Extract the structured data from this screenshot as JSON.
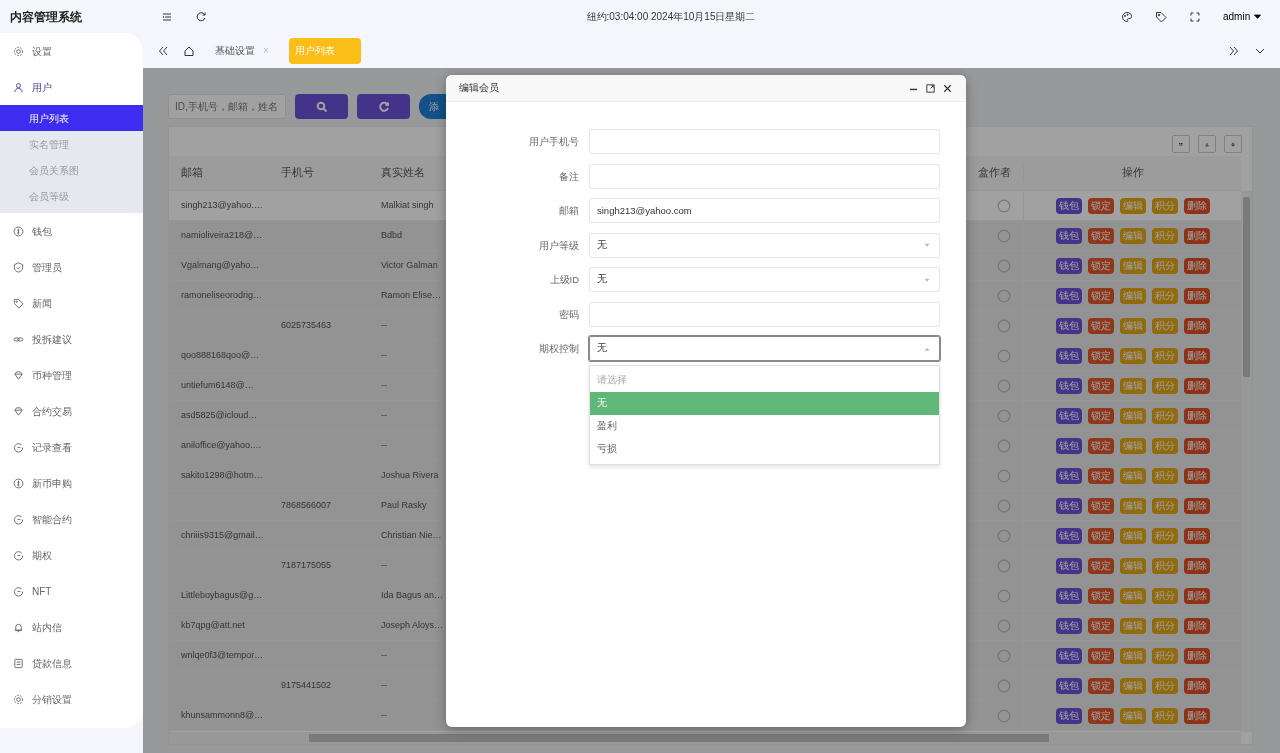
{
  "sidebar": {
    "title": "内容管理系统",
    "items": [
      {
        "label": "设置",
        "expanded": false
      },
      {
        "label": "用户",
        "expanded": true,
        "children": [
          {
            "label": "用户列表",
            "selected": true
          },
          {
            "label": "实名管理",
            "selected": false
          },
          {
            "label": "会员关系图",
            "selected": false
          },
          {
            "label": "会员等级",
            "selected": false
          }
        ]
      },
      {
        "label": "钱包",
        "expanded": false
      },
      {
        "label": "管理员",
        "expanded": false
      },
      {
        "label": "新闻",
        "expanded": false
      },
      {
        "label": "投拆建议",
        "expanded": false
      },
      {
        "label": "币种管理",
        "expanded": false
      },
      {
        "label": "合约交易",
        "expanded": false
      },
      {
        "label": "记录查看",
        "expanded": false
      },
      {
        "label": "新币申购",
        "expanded": false
      },
      {
        "label": "智能合约",
        "expanded": false
      },
      {
        "label": "期权",
        "expanded": false
      },
      {
        "label": "NFT",
        "expanded": false
      },
      {
        "label": "站内信",
        "expanded": false
      },
      {
        "label": "贷款信息",
        "expanded": false
      },
      {
        "label": "分销设置",
        "expanded": false
      }
    ]
  },
  "topbar": {
    "clock": "纽约:03:04:00 2024年10月15日星期二",
    "user": "admin"
  },
  "tabs": [
    {
      "label": "基础设置",
      "selected": false,
      "close": "×"
    },
    {
      "label": "用户列表",
      "selected": true
    }
  ],
  "toolbar": {
    "search": {
      "placeholder": "ID,手机号，邮箱，姓名"
    },
    "add_button": "添"
  },
  "table": {
    "columns": [
      "邮箱",
      "手机号",
      "真实姓名",
      "盒作者",
      "操作"
    ],
    "rows": [
      {
        "email": "singh213@yahoo.…",
        "name": "Malkiat singh",
        "selected": true,
        "actions": [
          "钱包",
          "锁定",
          "编辑",
          "积分",
          "删除"
        ]
      },
      {
        "email": "namioliveira218@…",
        "name": "Bdbd",
        "selected": false,
        "actions": [
          "钱包",
          "锁定",
          "编辑",
          "积分",
          "删除"
        ]
      },
      {
        "email": "Vgalmang@yaho…",
        "name": "Victor Galman",
        "selected": false,
        "actions": [
          "钱包",
          "锁定",
          "编辑",
          "积分",
          "删除"
        ]
      },
      {
        "email": "ramoneliseorodrig…",
        "name": "Ramon Elise…",
        "selected": false,
        "actions": [
          "钱包",
          "锁定",
          "编辑",
          "积分",
          "删除"
        ]
      },
      {
        "phone": "6025735463",
        "name": "--",
        "selected": false,
        "actions": [
          "钱包",
          "锁定",
          "编辑",
          "积分",
          "删除"
        ]
      },
      {
        "email": "qoo888168qoo@…",
        "name": "--",
        "selected": false,
        "actions": [
          "钱包",
          "锁定",
          "编辑",
          "积分",
          "删除"
        ]
      },
      {
        "email": "untiefum6148@…",
        "name": "--",
        "selected": false,
        "actions": [
          "钱包",
          "锁定",
          "编辑",
          "积分",
          "删除"
        ]
      },
      {
        "email": "asd5825@icloud…",
        "name": "--",
        "selected": false,
        "actions": [
          "钱包",
          "锁定",
          "编辑",
          "积分",
          "删除"
        ]
      },
      {
        "email": "aniloffice@yahoo.…",
        "name": "--",
        "selected": false,
        "actions": [
          "钱包",
          "锁定",
          "编辑",
          "积分",
          "删除"
        ]
      },
      {
        "email": "sakito1298@hotm…",
        "name": "Joshua Rivera",
        "selected": false,
        "actions": [
          "钱包",
          "锁定",
          "编辑",
          "积分",
          "删除"
        ]
      },
      {
        "phone": "7868566007",
        "name": "Paul Rasky",
        "selected": false,
        "actions": [
          "钱包",
          "锁定",
          "编辑",
          "积分",
          "删除"
        ]
      },
      {
        "email": "chriiis9315@gmail…",
        "name": "Christian Nie…",
        "selected": false,
        "actions": [
          "钱包",
          "锁定",
          "编辑",
          "积分",
          "删除"
        ]
      },
      {
        "phone": "7187175055",
        "name": "--",
        "selected": false,
        "actions": [
          "钱包",
          "锁定",
          "编辑",
          "积分",
          "删除"
        ]
      },
      {
        "email": "Littleboybagus@g…",
        "name": "Ida Bagus an…",
        "selected": false,
        "actions": [
          "钱包",
          "锁定",
          "编辑",
          "积分",
          "删除"
        ]
      },
      {
        "email": "kb7qpg@att.net",
        "name": "Joseph Aloys…",
        "selected": false,
        "actions": [
          "钱包",
          "锁定",
          "编辑",
          "积分",
          "删除"
        ]
      },
      {
        "email": "wnlqe0f3@tempor…",
        "name": "--",
        "selected": false,
        "actions": [
          "钱包",
          "锁定",
          "编辑",
          "积分",
          "删除"
        ]
      },
      {
        "phone": "9175441502",
        "name": "--",
        "selected": false,
        "actions": [
          "钱包",
          "锁定",
          "编辑",
          "积分",
          "删除"
        ]
      },
      {
        "email": "khunsammonn8@…",
        "name": "--",
        "selected": false,
        "actions": [
          "钱包",
          "锁定",
          "编辑",
          "积分",
          "删除"
        ]
      }
    ]
  },
  "modal": {
    "title": "编辑会员",
    "fields": [
      {
        "label": "用户手机号",
        "kind": "text"
      },
      {
        "label": "备注",
        "kind": "text"
      },
      {
        "label": "邮箱",
        "kind": "text",
        "value": "singh213@yahoo.com"
      },
      {
        "label": "用户等级",
        "kind": "select",
        "value": "无",
        "open": false
      },
      {
        "label": "上级ID",
        "kind": "select",
        "value": "无",
        "open": false
      },
      {
        "label": "密码",
        "kind": "text"
      },
      {
        "label": "期权控制",
        "kind": "select",
        "value": "无",
        "open": true,
        "options": [
          {
            "label": "请选择",
            "kind": "placeholder",
            "selected": false
          },
          {
            "label": "无",
            "selected": true
          },
          {
            "label": "盈利",
            "selected": false
          },
          {
            "label": "亏损",
            "selected": false
          }
        ]
      }
    ]
  }
}
